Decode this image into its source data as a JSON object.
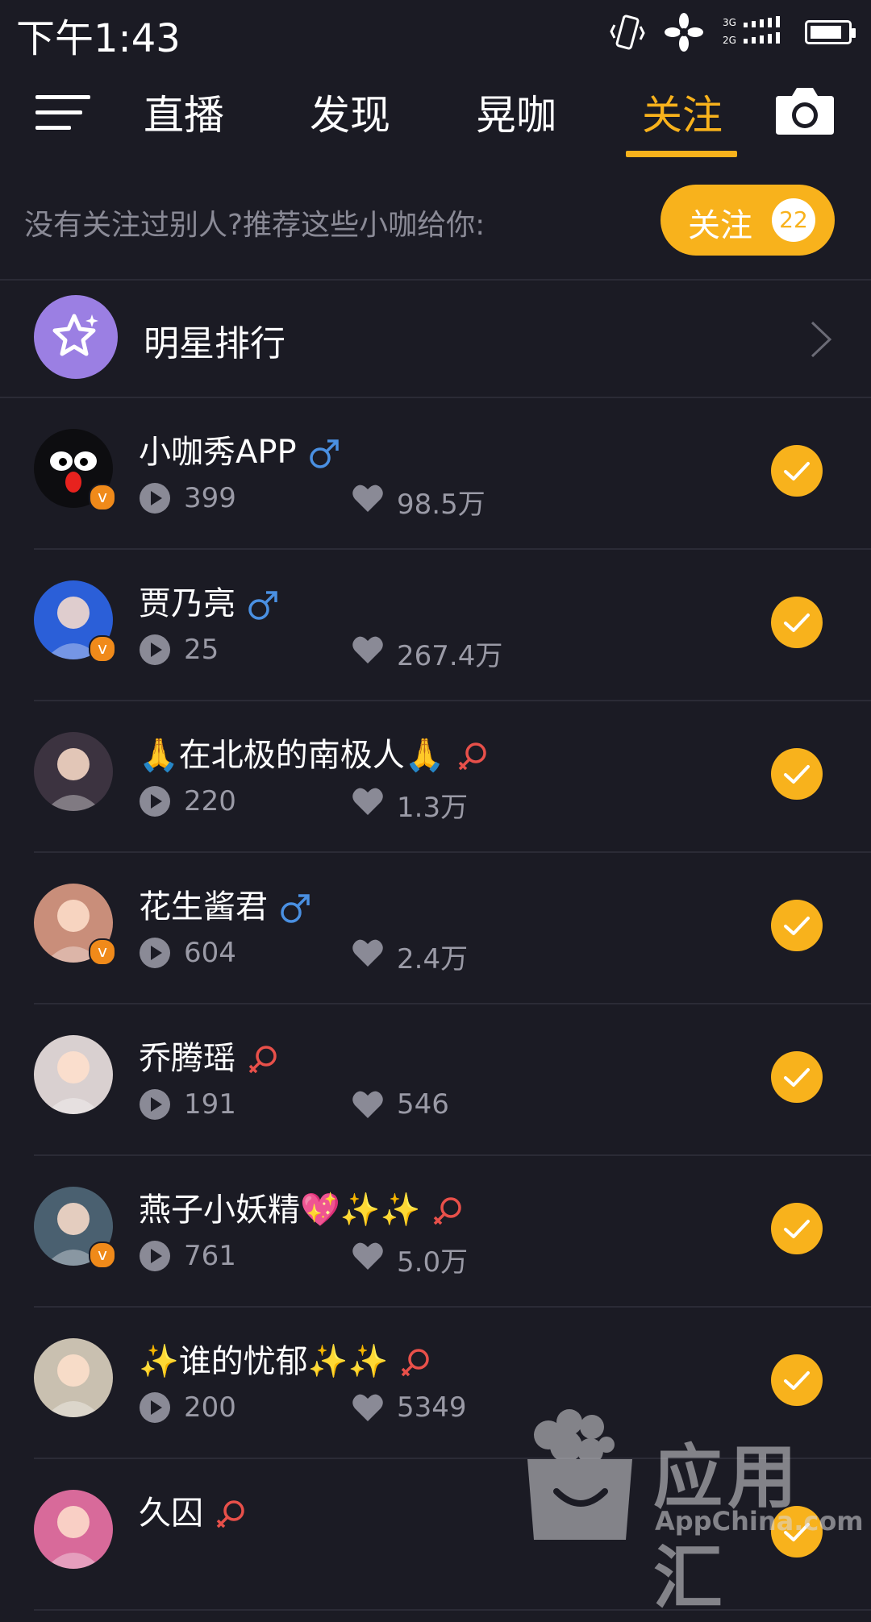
{
  "status": {
    "time": "下午1:43",
    "network_top": "3G",
    "network_bottom": "2G"
  },
  "nav": {
    "tabs": [
      {
        "label": "直播"
      },
      {
        "label": "发现"
      },
      {
        "label": "晃咖"
      },
      {
        "label": "关注",
        "active": true
      }
    ]
  },
  "recommend": {
    "text": "没有关注过别人?推荐这些小咖给你:",
    "follow_label": "关注",
    "follow_count": "22"
  },
  "ranking": {
    "label": "明星排行"
  },
  "users": [
    {
      "name": "小咖秀APP",
      "gender": "male",
      "plays": "399",
      "likes": "98.5万",
      "verified": true,
      "checked": true
    },
    {
      "name": "贾乃亮",
      "gender": "male",
      "plays": "25",
      "likes": "267.4万",
      "verified": true,
      "checked": true
    },
    {
      "name": "🙏在北极的南极人🙏",
      "gender": "female",
      "plays": "220",
      "likes": "1.3万",
      "verified": false,
      "checked": true
    },
    {
      "name": "花生酱君",
      "gender": "male",
      "plays": "604",
      "likes": "2.4万",
      "verified": true,
      "checked": true
    },
    {
      "name": "乔腾瑶",
      "gender": "female",
      "plays": "191",
      "likes": "546",
      "verified": false,
      "checked": true
    },
    {
      "name": "燕子小妖精💖✨✨",
      "gender": "female",
      "plays": "761",
      "likes": "5.0万",
      "verified": true,
      "checked": true
    },
    {
      "name": "✨谁的忧郁✨✨",
      "gender": "female",
      "plays": "200",
      "likes": "5349",
      "verified": false,
      "checked": true
    },
    {
      "name": "久囚",
      "gender": "female",
      "plays": "",
      "likes": "",
      "verified": false,
      "checked": true
    }
  ],
  "colors": {
    "accent": "#f8b21c",
    "background": "#1b1b24",
    "male": "#4a90e2",
    "female": "#e8504a",
    "muted": "#9a9aa6"
  },
  "watermark": {
    "big": "应用汇",
    "small": "AppChina.com"
  }
}
